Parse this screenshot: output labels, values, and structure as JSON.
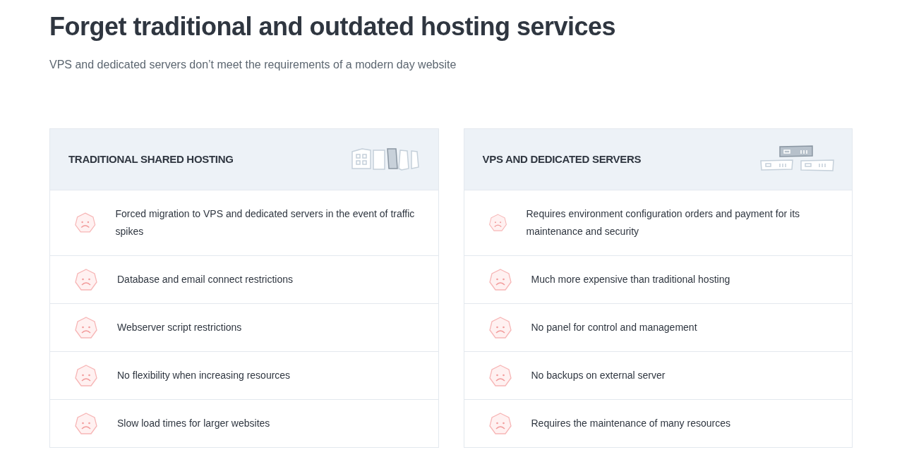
{
  "heading": "Forget traditional and outdated hosting services",
  "subheading": "VPS and dedicated servers don’t meet the requirements of a modern day website",
  "cards": [
    {
      "kind": "shared",
      "title": "TRADITIONAL SHARED HOSTING",
      "items": [
        "Forced migration to VPS and dedicated servers in the event of traffic spikes",
        "Database and email connect restrictions",
        "Webserver script restrictions",
        "No flexibility when increasing resources",
        "Slow load times for larger websites"
      ]
    },
    {
      "kind": "servers",
      "title": "VPS AND DEDICATED SERVERS",
      "items": [
        "Requires environment configuration orders and payment for its maintenance and security",
        "Much more expensive than traditional hosting",
        "No panel for control and management",
        "No backups on external server",
        "Requires the maintenance of many resources"
      ]
    }
  ]
}
